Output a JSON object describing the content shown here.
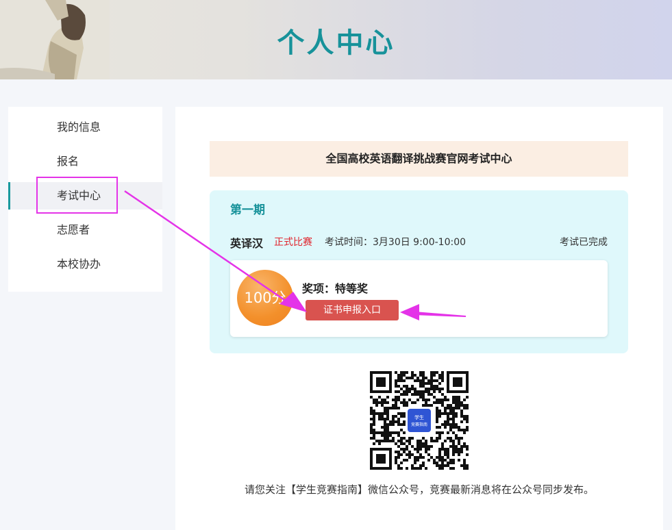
{
  "header": {
    "title": "个人中心"
  },
  "sidebar": {
    "items": [
      {
        "label": "我的信息"
      },
      {
        "label": "报名"
      },
      {
        "label": "考试中心"
      },
      {
        "label": "志愿者"
      },
      {
        "label": "本校协办"
      }
    ],
    "active_index": 2
  },
  "main": {
    "site_title": "全国高校英语翻译挑战赛官网考试中心",
    "period": {
      "title": "第一期",
      "exam": {
        "name": "英译汉",
        "type": "正式比赛",
        "time": "考试时间：3月30日 9:00-10:00",
        "status": "考试已完成"
      },
      "result": {
        "score": "100分",
        "award": "奖项：特等奖",
        "cert_button": "证书申报入口"
      }
    },
    "qr": {
      "caption": "请您关注【学生竞赛指南】微信公众号，竞赛最新消息将在公众号同步发布。",
      "logo_text_1": "学生",
      "logo_text_2": "竞赛指南"
    }
  },
  "colors": {
    "accent": "#17929a",
    "button": "#d9534f",
    "annotation": "#e433e8",
    "red_text": "#e0242c"
  }
}
